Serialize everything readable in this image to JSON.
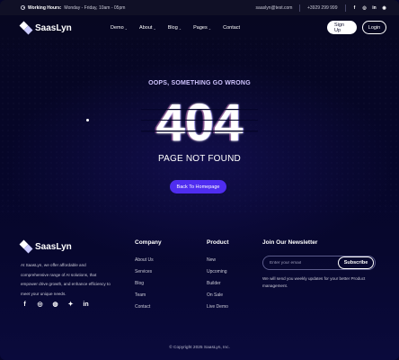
{
  "topbar": {
    "hours_label": "Working Hours:",
    "hours_value": "Monday - Friday, 10am - 05pm",
    "email": "saaslyn@test.com",
    "phone": "+3929 299 999",
    "socials": [
      {
        "icon": "facebook-icon",
        "glyph": "f"
      },
      {
        "icon": "instagram-icon",
        "glyph": "◎"
      },
      {
        "icon": "linkedin-icon",
        "glyph": "in"
      },
      {
        "icon": "whatsapp-icon",
        "glyph": "◉"
      }
    ]
  },
  "nav": {
    "logo": "SaasLyn",
    "menu": [
      {
        "label": "Demo",
        "dropdown": true
      },
      {
        "label": "About",
        "dropdown": true
      },
      {
        "label": "Blog",
        "dropdown": true
      },
      {
        "label": "Pages",
        "dropdown": true
      },
      {
        "label": "Contact",
        "dropdown": false
      }
    ],
    "signup_label": "Sign Up",
    "login_label": "Login"
  },
  "hero": {
    "oops": "OOPS, SOMETHING GO WRONG",
    "code": "404",
    "not_found": "PAGE NOT FOUND",
    "back_label": "Back To Homepage"
  },
  "footer": {
    "logo": "SaasLyn",
    "description": "At SaasLyn, we offer affordable and comprehensive range of AI solutions, that empower drive growth, and enhance efficiency to meet your unique needs.",
    "socials": [
      {
        "icon": "facebook-icon",
        "glyph": "f"
      },
      {
        "icon": "instagram-icon",
        "glyph": "◎"
      },
      {
        "icon": "discord-icon",
        "glyph": "◍"
      },
      {
        "icon": "twitter-icon",
        "glyph": "✦"
      },
      {
        "icon": "linkedin-icon",
        "glyph": "in"
      }
    ],
    "company": {
      "title": "Company",
      "links": [
        "About Us",
        "Services",
        "Blog",
        "Team",
        "Contact"
      ]
    },
    "product": {
      "title": "Product",
      "links": [
        "New",
        "Upcoming",
        "Builder",
        "On Sale",
        "Live Demo"
      ]
    },
    "newsletter": {
      "title": "Join Our Newsletter",
      "placeholder": "Enter your email",
      "subscribe_label": "Subscribe",
      "note": "We will send you weekly updates for your better Product management."
    },
    "copyright": "© Copyright 2025 SaasLyn, Inc."
  },
  "colors": {
    "background": "#05052a",
    "accent": "#4f2df0",
    "oops_text": "#cfc3ff"
  }
}
